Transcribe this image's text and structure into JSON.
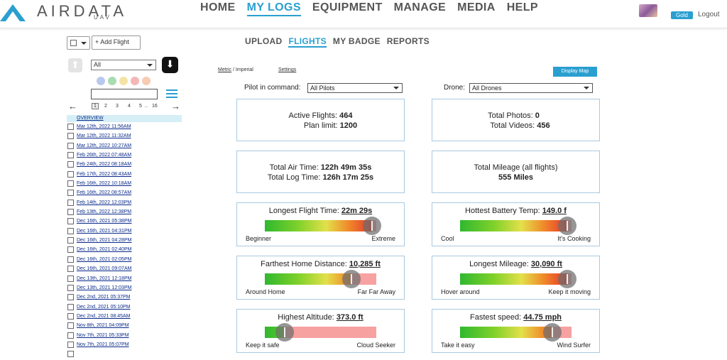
{
  "brand": {
    "name": "AIRDATA",
    "sub": "UAV",
    "accent": "#2a9fd0"
  },
  "nav": {
    "items": [
      {
        "label": "HOME",
        "active": false
      },
      {
        "label": "MY LOGS",
        "active": true
      },
      {
        "label": "EQUIPMENT",
        "active": false
      },
      {
        "label": "MANAGE",
        "active": false
      },
      {
        "label": "MEDIA",
        "active": false
      },
      {
        "label": "HELP",
        "active": false
      }
    ]
  },
  "user": {
    "badge": "Gold",
    "logout": "Logout"
  },
  "sidebar": {
    "add_flight": "+ Add Flight",
    "filter": "All",
    "color_dots": [
      "#b9c9ee",
      "#a9dcb0",
      "#f5e3a5",
      "#f5b6b6",
      "#f7ccb0"
    ],
    "pager": {
      "prev": "←",
      "next": "→",
      "pages": [
        "1",
        "2",
        "3",
        "4",
        "5",
        "..",
        "16"
      ]
    },
    "overview": "OVERVIEW",
    "flights": [
      "Mar 12th, 2022 11:56AM",
      "Mar 12th, 2022 11:32AM",
      "Mar 12th, 2022 10:27AM",
      "Feb 26th, 2022 07:48AM",
      "Feb 24th, 2022 08:18AM",
      "Feb 17th, 2022 08:43AM",
      "Feb 16th, 2022 10:18AM",
      "Feb 16th, 2022 08:57AM",
      "Feb 14th, 2022 12:03PM",
      "Feb 13th, 2022 12:38PM",
      "Dec 16th, 2021 05:38PM",
      "Dec 16th, 2021 04:31PM",
      "Dec 16th, 2021 04:28PM",
      "Dec 16th, 2021 02:40PM",
      "Dec 16th, 2021 02:05PM",
      "Dec 16th, 2021 09:07AM",
      "Dec 13th, 2021 12:18PM",
      "Dec 13th, 2021 12:03PM",
      "Dec 2nd, 2021 05:37PM",
      "Dec 2nd, 2021 05:10PM",
      "Dec 2nd, 2021 08:45AM",
      "Nov 8th, 2021 04:09PM",
      "Nov 7th, 2021 05:33PM",
      "Nov 7th, 2021 05:07PM",
      ""
    ]
  },
  "subnav": {
    "items": [
      {
        "label": "UPLOAD",
        "active": false
      },
      {
        "label": "FLIGHTS",
        "active": true
      },
      {
        "label": "MY BADGE",
        "active": false
      },
      {
        "label": "REPORTS",
        "active": false
      }
    ]
  },
  "units": {
    "metric": "Metric",
    "sep": " / ",
    "imperial": "Imperial",
    "settings": "Settings"
  },
  "display_map": "Display Map",
  "filters": {
    "pilot_label": "Pilot in command:",
    "pilot_value": "All Pilots",
    "drone_label": "Drone:",
    "drone_value": "All Drones"
  },
  "stats": {
    "active_flights_label": "Active Flights:",
    "active_flights": "464",
    "plan_limit_label": "Plan limit:",
    "plan_limit": "1200",
    "total_photos_label": "Total Photos:",
    "total_photos": "0",
    "total_videos_label": "Total Videos:",
    "total_videos": "456",
    "air_time_label": "Total Air Time:",
    "air_time": "122h 49m 35s",
    "log_time_label": "Total Log Time:",
    "log_time": "126h 17m 25s",
    "mileage_label": "Total Mileage (all flights)",
    "mileage": "555 Miles"
  },
  "gauges": [
    {
      "title": "Longest Flight Time:",
      "value": "22m 29s",
      "left": "Beginner",
      "right": "Extreme",
      "level": 0.96
    },
    {
      "title": "Hottest Battery Temp:",
      "value": "149.0 f",
      "left": "Cool",
      "right": "It's Cooking",
      "level": 0.96
    },
    {
      "title": "Farthest Home Distance:",
      "value": "10,285 ft",
      "left": "Around Home",
      "right": "Far Far Away",
      "level": 0.78
    },
    {
      "title": "Longest Mileage:",
      "value": "30,090 ft",
      "left": "Hover around",
      "right": "Keep it moving",
      "level": 0.96
    },
    {
      "title": "Highest Altitude:",
      "value": "373.0 ft",
      "left": "Keep it safe",
      "right": "Cloud Seeker",
      "level": 0.18
    },
    {
      "title": "Fastest speed:",
      "value": "44.75 mph",
      "left": "Take it easy",
      "right": "Wind Surfer",
      "level": 0.83
    }
  ]
}
